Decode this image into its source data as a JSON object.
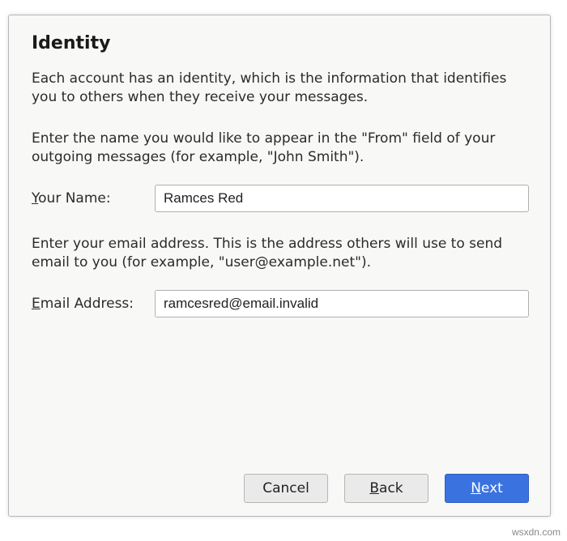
{
  "dialog": {
    "title": "Identity",
    "intro": "Each account has an identity, which is the information that identifies you to others when they receive your messages.",
    "name_help": "Enter the name you would like to appear in the \"From\" field of your outgoing messages (for example, \"John Smith\").",
    "name_label_pre": "Y",
    "name_label_post": "our Name:",
    "name_value": "Ramces Red",
    "email_help": "Enter your email address. This is the address others will use to send email to you (for example, \"user@example.net\").",
    "email_label_pre": "E",
    "email_label_post": "mail Address:",
    "email_value": "ramcesred@email.invalid"
  },
  "buttons": {
    "cancel": "Cancel",
    "back_pre": "B",
    "back_post": "ack",
    "next_pre": "N",
    "next_post": "ext"
  },
  "watermark": "wsxdn.com"
}
